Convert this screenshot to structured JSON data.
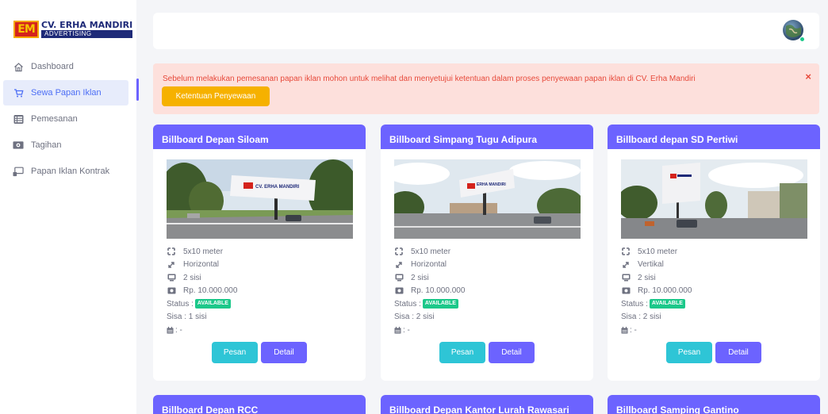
{
  "brand": {
    "name": "CV. ERHA MANDIRI",
    "sub": "ADVERTISING",
    "mark": "EM"
  },
  "sidebar": {
    "items": [
      {
        "label": "Dashboard",
        "icon": "home-icon"
      },
      {
        "label": "Sewa Papan Iklan",
        "icon": "cart-icon",
        "active": true
      },
      {
        "label": "Pemesanan",
        "icon": "list-icon"
      },
      {
        "label": "Tagihan",
        "icon": "money-icon"
      },
      {
        "label": "Papan Iklan Kontrak",
        "icon": "billboard-icon"
      }
    ]
  },
  "alert": {
    "text": "Sebelum melakukan pemesanan papan iklan mohon untuk melihat dan menyetujui ketentuan dalam proses penyewaan papan iklan di CV. Erha Mandiri",
    "button": "Ketentuan Penyewaan",
    "close": "×"
  },
  "cards": [
    {
      "title": "Billboard Depan Siloam",
      "size": "5x10 meter",
      "orientation": "Horizontal",
      "sides": "2 sisi",
      "price": "Rp. 10.000.000",
      "status_label": "Status :",
      "status": "AVAILABLE",
      "remaining": "Sisa : 1 sisi",
      "date": ": -",
      "pesan": "Pesan",
      "detail": "Detail"
    },
    {
      "title": "Billboard Simpang Tugu Adipura",
      "size": "5x10 meter",
      "orientation": "Horizontal",
      "sides": "2 sisi",
      "price": "Rp. 10.000.000",
      "status_label": "Status :",
      "status": "AVAILABLE",
      "remaining": "Sisa : 2 sisi",
      "date": ": -",
      "pesan": "Pesan",
      "detail": "Detail"
    },
    {
      "title": "Billboard depan SD Pertiwi",
      "size": "5x10 meter",
      "orientation": "Vertikal",
      "sides": "2 sisi",
      "price": "Rp. 10.000.000",
      "status_label": "Status :",
      "status": "AVAILABLE",
      "remaining": "Sisa : 2 sisi",
      "date": ": -",
      "pesan": "Pesan",
      "detail": "Detail"
    },
    {
      "title": "Billboard Depan RCC"
    },
    {
      "title": "Billboard Depan Kantor Lurah Rawasari"
    },
    {
      "title": "Billboard Samping Gantino"
    }
  ],
  "colors": {
    "accent": "#6c63ff",
    "available": "#1cc88a",
    "pesan": "#2ec5d6",
    "warning": "#f6b100",
    "alert_bg": "#fde0dc",
    "alert_text": "#e74a3b"
  }
}
